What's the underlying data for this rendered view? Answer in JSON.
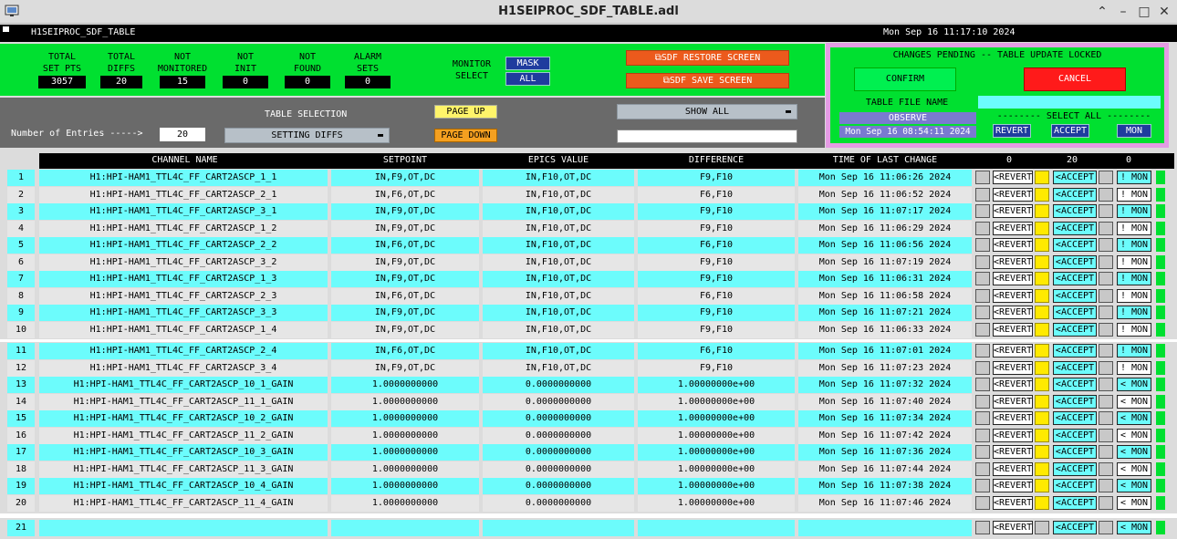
{
  "window": {
    "title": "H1SEIPROC_SDF_TABLE.adl"
  },
  "header": {
    "left": "H1SEIPROC_SDF_TABLE",
    "right": "Mon Sep 16 11:17:10 2024"
  },
  "stats": [
    {
      "label1": "TOTAL",
      "label2": "SET PTS",
      "value": "3057"
    },
    {
      "label1": "TOTAL",
      "label2": "DIFFS",
      "value": "20"
    },
    {
      "label1": "NOT",
      "label2": "MONITORED",
      "value": "15"
    },
    {
      "label1": "NOT",
      "label2": "INIT",
      "value": "0"
    },
    {
      "label1": "NOT",
      "label2": "FOUND",
      "value": "0"
    },
    {
      "label1": "ALARM",
      "label2": "SETS",
      "value": "0"
    }
  ],
  "monitor_select": {
    "label1": "MONITOR",
    "label2": "SELECT",
    "mask": "MASK",
    "all": "ALL"
  },
  "buttons": {
    "restore": "SDF RESTORE SCREEN",
    "save": "SDF SAVE SCREEN",
    "page_up": "PAGE UP",
    "page_down": "PAGE DOWN",
    "confirm": "CONFIRM",
    "cancel": "CANCEL"
  },
  "table_selection": {
    "label": "TABLE SELECTION",
    "value": "SETTING DIFFS",
    "show": "SHOW ALL"
  },
  "entries": {
    "label": "Number of Entries ----->",
    "value": "20"
  },
  "pending": {
    "message": "CHANGES PENDING -- TABLE UPDATE LOCKED",
    "table_file_label": "TABLE FILE NAME",
    "file_name": "OBSERVE",
    "file_time": "Mon Sep 16 08:54:11 2024",
    "select_all": "-------- SELECT ALL --------",
    "revert": "REVERT",
    "accept": "ACCEPT",
    "mon": "MON"
  },
  "columns": {
    "channel": "CHANNEL NAME",
    "setpoint": "SETPOINT",
    "epics": "EPICS VALUE",
    "diff": "DIFFERENCE",
    "time": "TIME OF LAST CHANGE",
    "count_revert": "0",
    "count_accept": "20",
    "count_mon": "0"
  },
  "row_buttons": {
    "revert": "<REVERT",
    "accept": "<ACCEPT",
    "mon_on": "! MON",
    "mon_mask": "< MON"
  },
  "rows": [
    {
      "n": "1",
      "name": "H1:HPI-HAM1_TTL4C_FF_CART2ASCP_1_1",
      "sp": "IN,F9,OT,DC",
      "ev": "IN,F10,OT,DC",
      "diff": "F9,F10",
      "time": "Mon Sep 16 11:06:26 2024",
      "mon": "! MON"
    },
    {
      "n": "2",
      "name": "H1:HPI-HAM1_TTL4C_FF_CART2ASCP_2_1",
      "sp": "IN,F6,OT,DC",
      "ev": "IN,F10,OT,DC",
      "diff": "F6,F10",
      "time": "Mon Sep 16 11:06:52 2024",
      "mon": "! MON"
    },
    {
      "n": "3",
      "name": "H1:HPI-HAM1_TTL4C_FF_CART2ASCP_3_1",
      "sp": "IN,F9,OT,DC",
      "ev": "IN,F10,OT,DC",
      "diff": "F9,F10",
      "time": "Mon Sep 16 11:07:17 2024",
      "mon": "! MON"
    },
    {
      "n": "4",
      "name": "H1:HPI-HAM1_TTL4C_FF_CART2ASCP_1_2",
      "sp": "IN,F9,OT,DC",
      "ev": "IN,F10,OT,DC",
      "diff": "F9,F10",
      "time": "Mon Sep 16 11:06:29 2024",
      "mon": "! MON"
    },
    {
      "n": "5",
      "name": "H1:HPI-HAM1_TTL4C_FF_CART2ASCP_2_2",
      "sp": "IN,F6,OT,DC",
      "ev": "IN,F10,OT,DC",
      "diff": "F6,F10",
      "time": "Mon Sep 16 11:06:56 2024",
      "mon": "! MON"
    },
    {
      "n": "6",
      "name": "H1:HPI-HAM1_TTL4C_FF_CART2ASCP_3_2",
      "sp": "IN,F9,OT,DC",
      "ev": "IN,F10,OT,DC",
      "diff": "F9,F10",
      "time": "Mon Sep 16 11:07:19 2024",
      "mon": "! MON"
    },
    {
      "n": "7",
      "name": "H1:HPI-HAM1_TTL4C_FF_CART2ASCP_1_3",
      "sp": "IN,F9,OT,DC",
      "ev": "IN,F10,OT,DC",
      "diff": "F9,F10",
      "time": "Mon Sep 16 11:06:31 2024",
      "mon": "! MON"
    },
    {
      "n": "8",
      "name": "H1:HPI-HAM1_TTL4C_FF_CART2ASCP_2_3",
      "sp": "IN,F6,OT,DC",
      "ev": "IN,F10,OT,DC",
      "diff": "F6,F10",
      "time": "Mon Sep 16 11:06:58 2024",
      "mon": "! MON"
    },
    {
      "n": "9",
      "name": "H1:HPI-HAM1_TTL4C_FF_CART2ASCP_3_3",
      "sp": "IN,F9,OT,DC",
      "ev": "IN,F10,OT,DC",
      "diff": "F9,F10",
      "time": "Mon Sep 16 11:07:21 2024",
      "mon": "! MON"
    },
    {
      "n": "10",
      "name": "H1:HPI-HAM1_TTL4C_FF_CART2ASCP_1_4",
      "sp": "IN,F9,OT,DC",
      "ev": "IN,F10,OT,DC",
      "diff": "F9,F10",
      "time": "Mon Sep 16 11:06:33 2024",
      "mon": "! MON"
    },
    {
      "n": "11",
      "name": "H1:HPI-HAM1_TTL4C_FF_CART2ASCP_2_4",
      "sp": "IN,F6,OT,DC",
      "ev": "IN,F10,OT,DC",
      "diff": "F6,F10",
      "time": "Mon Sep 16 11:07:01 2024",
      "mon": "! MON"
    },
    {
      "n": "12",
      "name": "H1:HPI-HAM1_TTL4C_FF_CART2ASCP_3_4",
      "sp": "IN,F9,OT,DC",
      "ev": "IN,F10,OT,DC",
      "diff": "F9,F10",
      "time": "Mon Sep 16 11:07:23 2024",
      "mon": "! MON"
    },
    {
      "n": "13",
      "name": "H1:HPI-HAM1_TTL4C_FF_CART2ASCP_10_1_GAIN",
      "sp": "1.0000000000",
      "ev": "0.0000000000",
      "diff": "1.00000000e+00",
      "time": "Mon Sep 16 11:07:32 2024",
      "mon": "< MON"
    },
    {
      "n": "14",
      "name": "H1:HPI-HAM1_TTL4C_FF_CART2ASCP_11_1_GAIN",
      "sp": "1.0000000000",
      "ev": "0.0000000000",
      "diff": "1.00000000e+00",
      "time": "Mon Sep 16 11:07:40 2024",
      "mon": "< MON"
    },
    {
      "n": "15",
      "name": "H1:HPI-HAM1_TTL4C_FF_CART2ASCP_10_2_GAIN",
      "sp": "1.0000000000",
      "ev": "0.0000000000",
      "diff": "1.00000000e+00",
      "time": "Mon Sep 16 11:07:34 2024",
      "mon": "< MON"
    },
    {
      "n": "16",
      "name": "H1:HPI-HAM1_TTL4C_FF_CART2ASCP_11_2_GAIN",
      "sp": "1.0000000000",
      "ev": "0.0000000000",
      "diff": "1.00000000e+00",
      "time": "Mon Sep 16 11:07:42 2024",
      "mon": "< MON"
    },
    {
      "n": "17",
      "name": "H1:HPI-HAM1_TTL4C_FF_CART2ASCP_10_3_GAIN",
      "sp": "1.0000000000",
      "ev": "0.0000000000",
      "diff": "1.00000000e+00",
      "time": "Mon Sep 16 11:07:36 2024",
      "mon": "< MON"
    },
    {
      "n": "18",
      "name": "H1:HPI-HAM1_TTL4C_FF_CART2ASCP_11_3_GAIN",
      "sp": "1.0000000000",
      "ev": "0.0000000000",
      "diff": "1.00000000e+00",
      "time": "Mon Sep 16 11:07:44 2024",
      "mon": "< MON"
    },
    {
      "n": "19",
      "name": "H1:HPI-HAM1_TTL4C_FF_CART2ASCP_10_4_GAIN",
      "sp": "1.0000000000",
      "ev": "0.0000000000",
      "diff": "1.00000000e+00",
      "time": "Mon Sep 16 11:07:38 2024",
      "mon": "< MON"
    },
    {
      "n": "20",
      "name": "H1:HPI-HAM1_TTL4C_FF_CART2ASCP_11_4_GAIN",
      "sp": "1.0000000000",
      "ev": "0.0000000000",
      "diff": "1.00000000e+00",
      "time": "Mon Sep 16 11:07:46 2024",
      "mon": "< MON"
    },
    {
      "n": "21",
      "name": "",
      "sp": "",
      "ev": "",
      "diff": "",
      "time": "",
      "mon": "< MON"
    }
  ],
  "colors": {
    "green": "#00e030",
    "cyan": "#6cfcfc",
    "grey_row": "#e6e6e6",
    "orange": "#ec5a1c",
    "red": "#ff1a1a",
    "blue_btn": "#1f3c9e"
  }
}
